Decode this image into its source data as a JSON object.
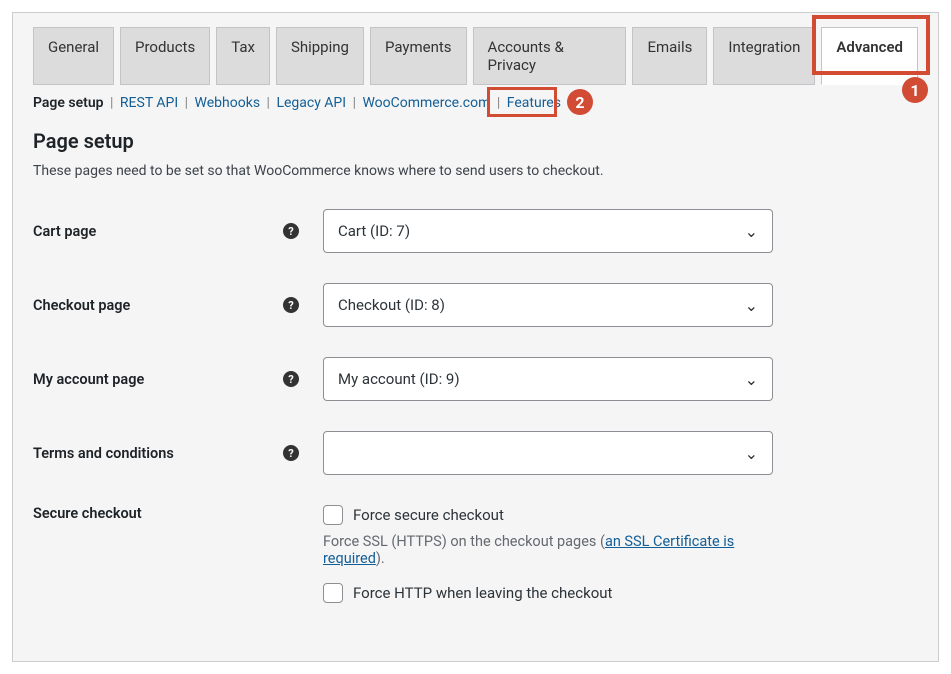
{
  "tabs": {
    "general": "General",
    "products": "Products",
    "tax": "Tax",
    "shipping": "Shipping",
    "payments": "Payments",
    "accounts_privacy": "Accounts & Privacy",
    "emails": "Emails",
    "integration": "Integration",
    "advanced": "Advanced",
    "active": "Advanced"
  },
  "subnav": {
    "page_setup": "Page setup",
    "rest_api": "REST API",
    "webhooks": "Webhooks",
    "legacy_api": "Legacy API",
    "woocommerce": "WooCommerce.com",
    "features": "Features"
  },
  "annotations": {
    "badge1": "1",
    "badge2": "2"
  },
  "heading": "Page setup",
  "description": "These pages need to be set so that WooCommerce knows where to send users to checkout.",
  "fields": {
    "cart_page": {
      "label": "Cart page",
      "value": "Cart (ID: 7)"
    },
    "checkout_page": {
      "label": "Checkout page",
      "value": "Checkout (ID: 8)"
    },
    "my_account_page": {
      "label": "My account page",
      "value": "My account (ID: 9)"
    },
    "terms": {
      "label": "Terms and conditions",
      "value": ""
    },
    "secure_checkout": {
      "label": "Secure checkout",
      "force_secure": "Force secure checkout",
      "ssl_hint_prefix": "Force SSL (HTTPS) on the checkout pages (",
      "ssl_link": "an SSL Certificate is required",
      "ssl_hint_suffix": ").",
      "force_http": "Force HTTP when leaving the checkout"
    }
  }
}
